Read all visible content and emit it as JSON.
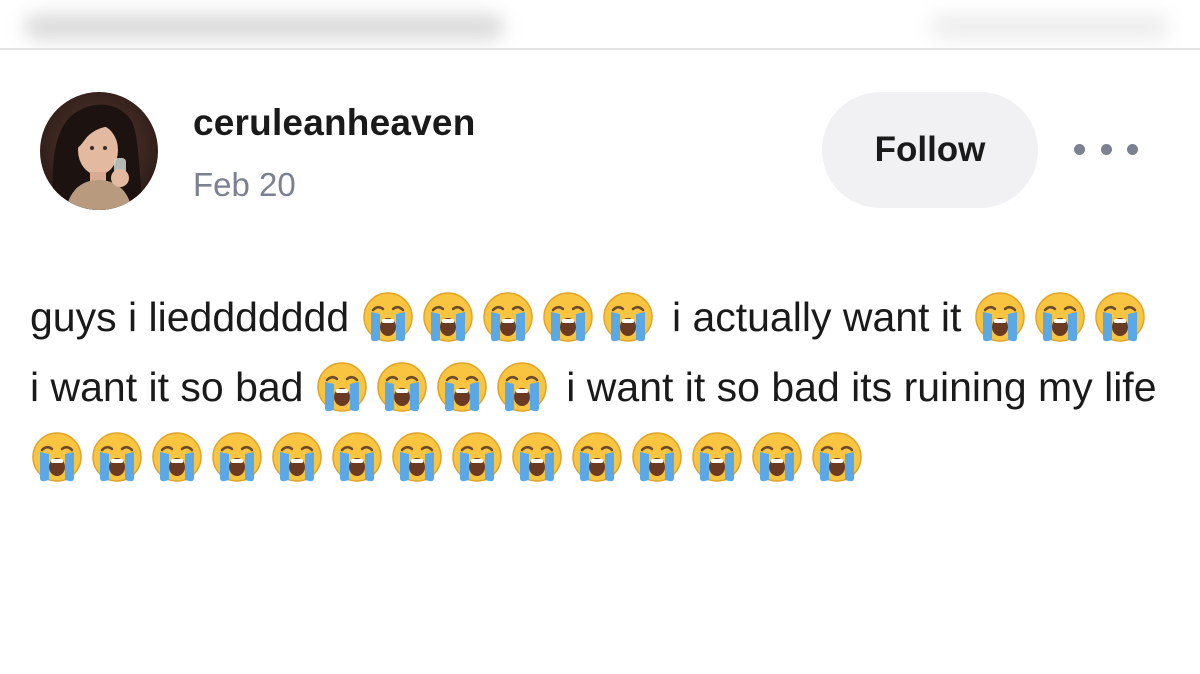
{
  "post": {
    "author": {
      "username": "ceruleanheaven",
      "date": "Feb 20"
    },
    "follow_label": "Follow",
    "more_icon": "more-horizontal-icon",
    "body_segments": [
      {
        "type": "text",
        "value": "guys i lieddddddd "
      },
      {
        "type": "emoji",
        "count": 5,
        "name": "loudly-crying-face"
      },
      {
        "type": "text",
        "value": "i actually want it "
      },
      {
        "type": "emoji",
        "count": 3,
        "name": "loudly-crying-face"
      },
      {
        "type": "text",
        "value": "i want it so bad "
      },
      {
        "type": "emoji",
        "count": 4,
        "name": "loudly-crying-face"
      },
      {
        "type": "text",
        "value": "i want it so bad its ruining my life "
      },
      {
        "type": "emoji",
        "count": 14,
        "name": "loudly-crying-face"
      }
    ]
  },
  "colors": {
    "background": "#ffffff",
    "username": "#1a1a1a",
    "date": "#7b8190",
    "follow_bg": "#f1f1f3",
    "emoji_face": "#f9c440",
    "emoji_tears": "#5aa9e6"
  }
}
